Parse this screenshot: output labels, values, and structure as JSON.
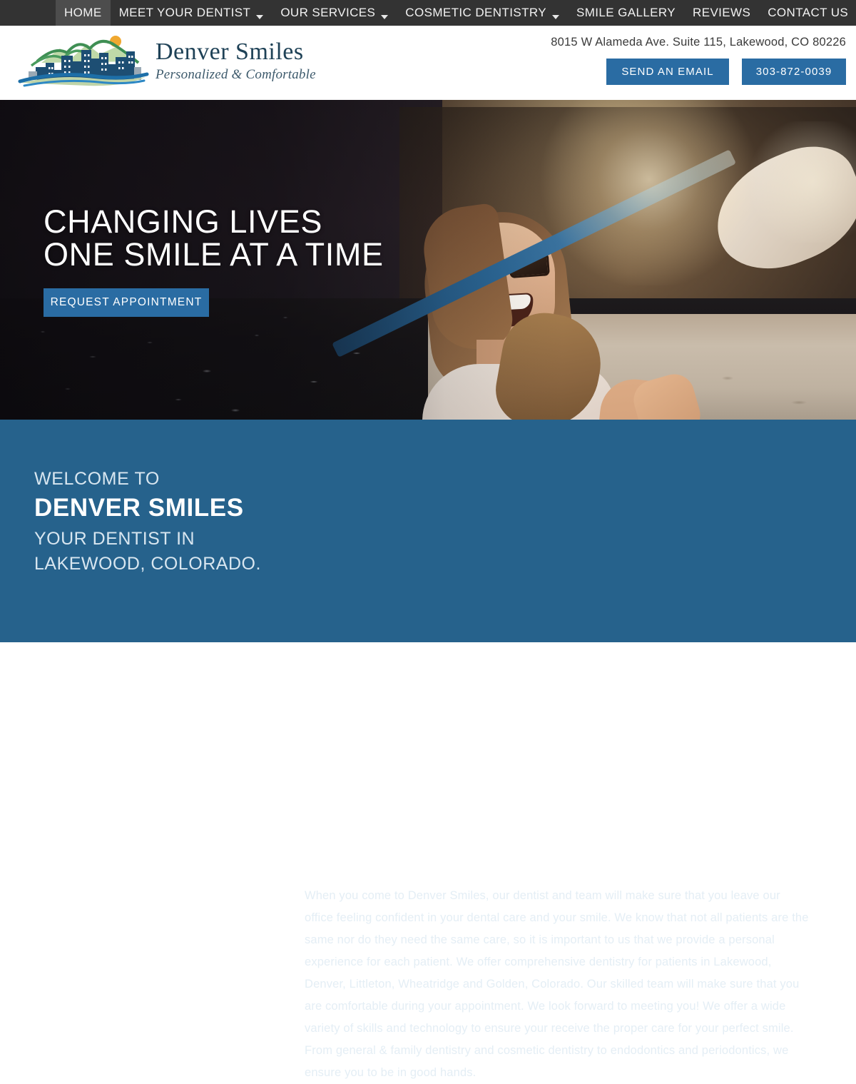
{
  "nav": {
    "items": [
      {
        "label": "HOME",
        "active": true,
        "has_dropdown": false
      },
      {
        "label": "MEET YOUR DENTIST",
        "active": false,
        "has_dropdown": true
      },
      {
        "label": "OUR SERVICES",
        "active": false,
        "has_dropdown": true
      },
      {
        "label": "COSMETIC DENTISTRY",
        "active": false,
        "has_dropdown": true
      },
      {
        "label": "SMILE GALLERY",
        "active": false,
        "has_dropdown": false
      },
      {
        "label": "REVIEWS",
        "active": false,
        "has_dropdown": false
      },
      {
        "label": "CONTACT US",
        "active": false,
        "has_dropdown": false
      }
    ]
  },
  "header": {
    "logo_title": "Denver Smiles",
    "logo_tagline": "Personalized & Comfortable",
    "address": "8015 W Alameda Ave. Suite 115, Lakewood, CO 80226",
    "email_button": "SEND AN EMAIL",
    "phone_button": "303-872-0039"
  },
  "hero": {
    "title_line1": "CHANGING LIVES",
    "title_line2": "ONE SMILE AT A TIME",
    "cta": "REQUEST APPOINTMENT"
  },
  "welcome": {
    "eyebrow": "WELCOME TO",
    "title": "DENVER SMILES",
    "subtitle": "YOUR DENTIST IN LAKEWOOD, COLORADO.",
    "paragraph": "When you come to Denver Smiles, our dentist and team will make sure that you leave our office feeling confident in your dental care and your smile. We know that not all patients are the same nor do they need the same care, so it is important to us that we provide a personal experience for each patient. We offer comprehensive dentistry for patients in Lakewood, Denver, Littleton, Wheatridge and Golden, Colorado. Our skilled team will make sure that you are comfortable during your appointment. We look forward to meeting you! We offer a wide variety of skills and technology to ensure your receive the proper care for your perfect smile. From general & family dentistry and cosmetic dentistry to endodontics and periodontics, we ensure you to be in good hands."
  },
  "colors": {
    "nav_bg": "#333333",
    "nav_active_bg": "#4d4d4d",
    "brand_blue": "#2a6ca3",
    "welcome_bg": "#26628c",
    "logo_navy": "#1f4257"
  }
}
